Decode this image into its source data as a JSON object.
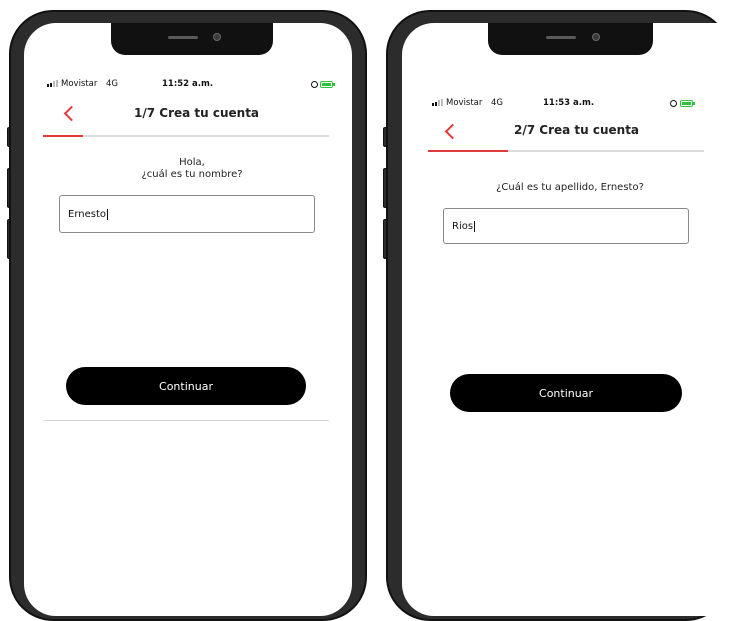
{
  "screens": [
    {
      "status": {
        "carrier": "Movistar",
        "network": "4G",
        "time": "11:52 a.m."
      },
      "header": {
        "title": "1/7 Crea tu cuenta",
        "progress_fraction": 0.14
      },
      "question_line1": "Hola,",
      "question_line2": "¿cuál es tu nombre?",
      "input_value": "Ernesto",
      "button_label": "Continuar"
    },
    {
      "status": {
        "carrier": "Movistar",
        "network": "4G",
        "time": "11:53 a.m."
      },
      "header": {
        "title": "2/7 Crea tu cuenta",
        "progress_fraction": 0.29
      },
      "question": "¿Cuál es tu apellido, Ernesto?",
      "input_value": "Rios",
      "button_label": "Continuar"
    }
  ],
  "colors": {
    "accent": "#e03a3a",
    "button": "#000000",
    "battery": "#2fbf3a",
    "frame": "#2c2c2c"
  }
}
